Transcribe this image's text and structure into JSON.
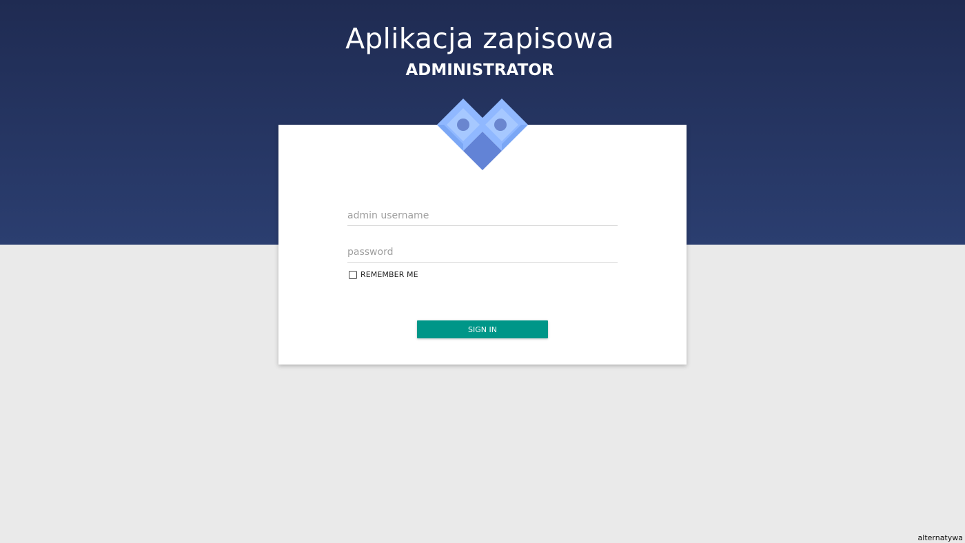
{
  "header": {
    "title": "Aplikacja zapisowa",
    "subtitle": "ADMINISTRATOR"
  },
  "login": {
    "username_placeholder": "admin username",
    "username_value": "",
    "password_placeholder": "password",
    "password_value": "",
    "remember_label": "REMEMBER ME",
    "remember_checked": false,
    "submit_label": "SIGN IN"
  },
  "footer": {
    "link_label": "alternatywa"
  },
  "colors": {
    "header_gradient_top": "#1f2b52",
    "header_gradient_bottom": "#2b3e70",
    "page_background": "#eaeaea",
    "accent_button": "#009688",
    "logo_light": "#90b8ff",
    "logo_mid": "#7ba7f5",
    "logo_dark": "#5f7fd0"
  },
  "icons": {
    "logo": "diamond-heart-logo-icon"
  }
}
